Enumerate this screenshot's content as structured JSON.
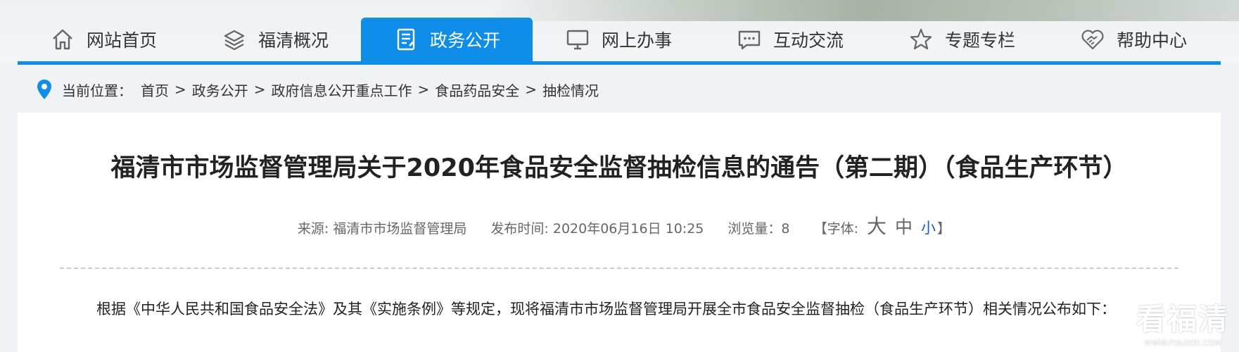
{
  "nav": {
    "items": [
      {
        "label": "网站首页",
        "icon": "home-icon"
      },
      {
        "label": "福清概况",
        "icon": "layers-icon"
      },
      {
        "label": "政务公开",
        "icon": "document-icon",
        "active": true
      },
      {
        "label": "网上办事",
        "icon": "monitor-icon"
      },
      {
        "label": "互动交流",
        "icon": "chat-icon"
      },
      {
        "label": "专题专栏",
        "icon": "star-icon"
      },
      {
        "label": "帮助中心",
        "icon": "handshake-icon"
      }
    ],
    "accent_color": "#0e8ee9"
  },
  "breadcrumb": {
    "prefix": "当前位置：",
    "items": [
      "首页",
      "政务公开",
      "政府信息公开重点工作",
      "食品药品安全",
      "抽检情况"
    ],
    "separator": ">"
  },
  "article": {
    "title": "福清市市场监督管理局关于2020年食品安全监督抽检信息的通告（第二期）（食品生产环节）",
    "meta": {
      "source": "来源: 福清市市场监督管理局",
      "published": "发布时间: 2020年06月16日 10:25",
      "views": "浏览量：8",
      "font_open": "【字体: ",
      "font_large": "大",
      "font_medium": "中",
      "font_small": "小",
      "font_close": "】"
    },
    "paragraph": "根据《中华人民共和国食品安全法》及其《实施条例》等规定，现将福清市市场监督管理局开展全市食品安全监督抽检（食品生产环节）相关情况公布如下："
  },
  "watermark": {
    "main": "看福清",
    "sub": "WWW.FQLOOK.COM"
  }
}
